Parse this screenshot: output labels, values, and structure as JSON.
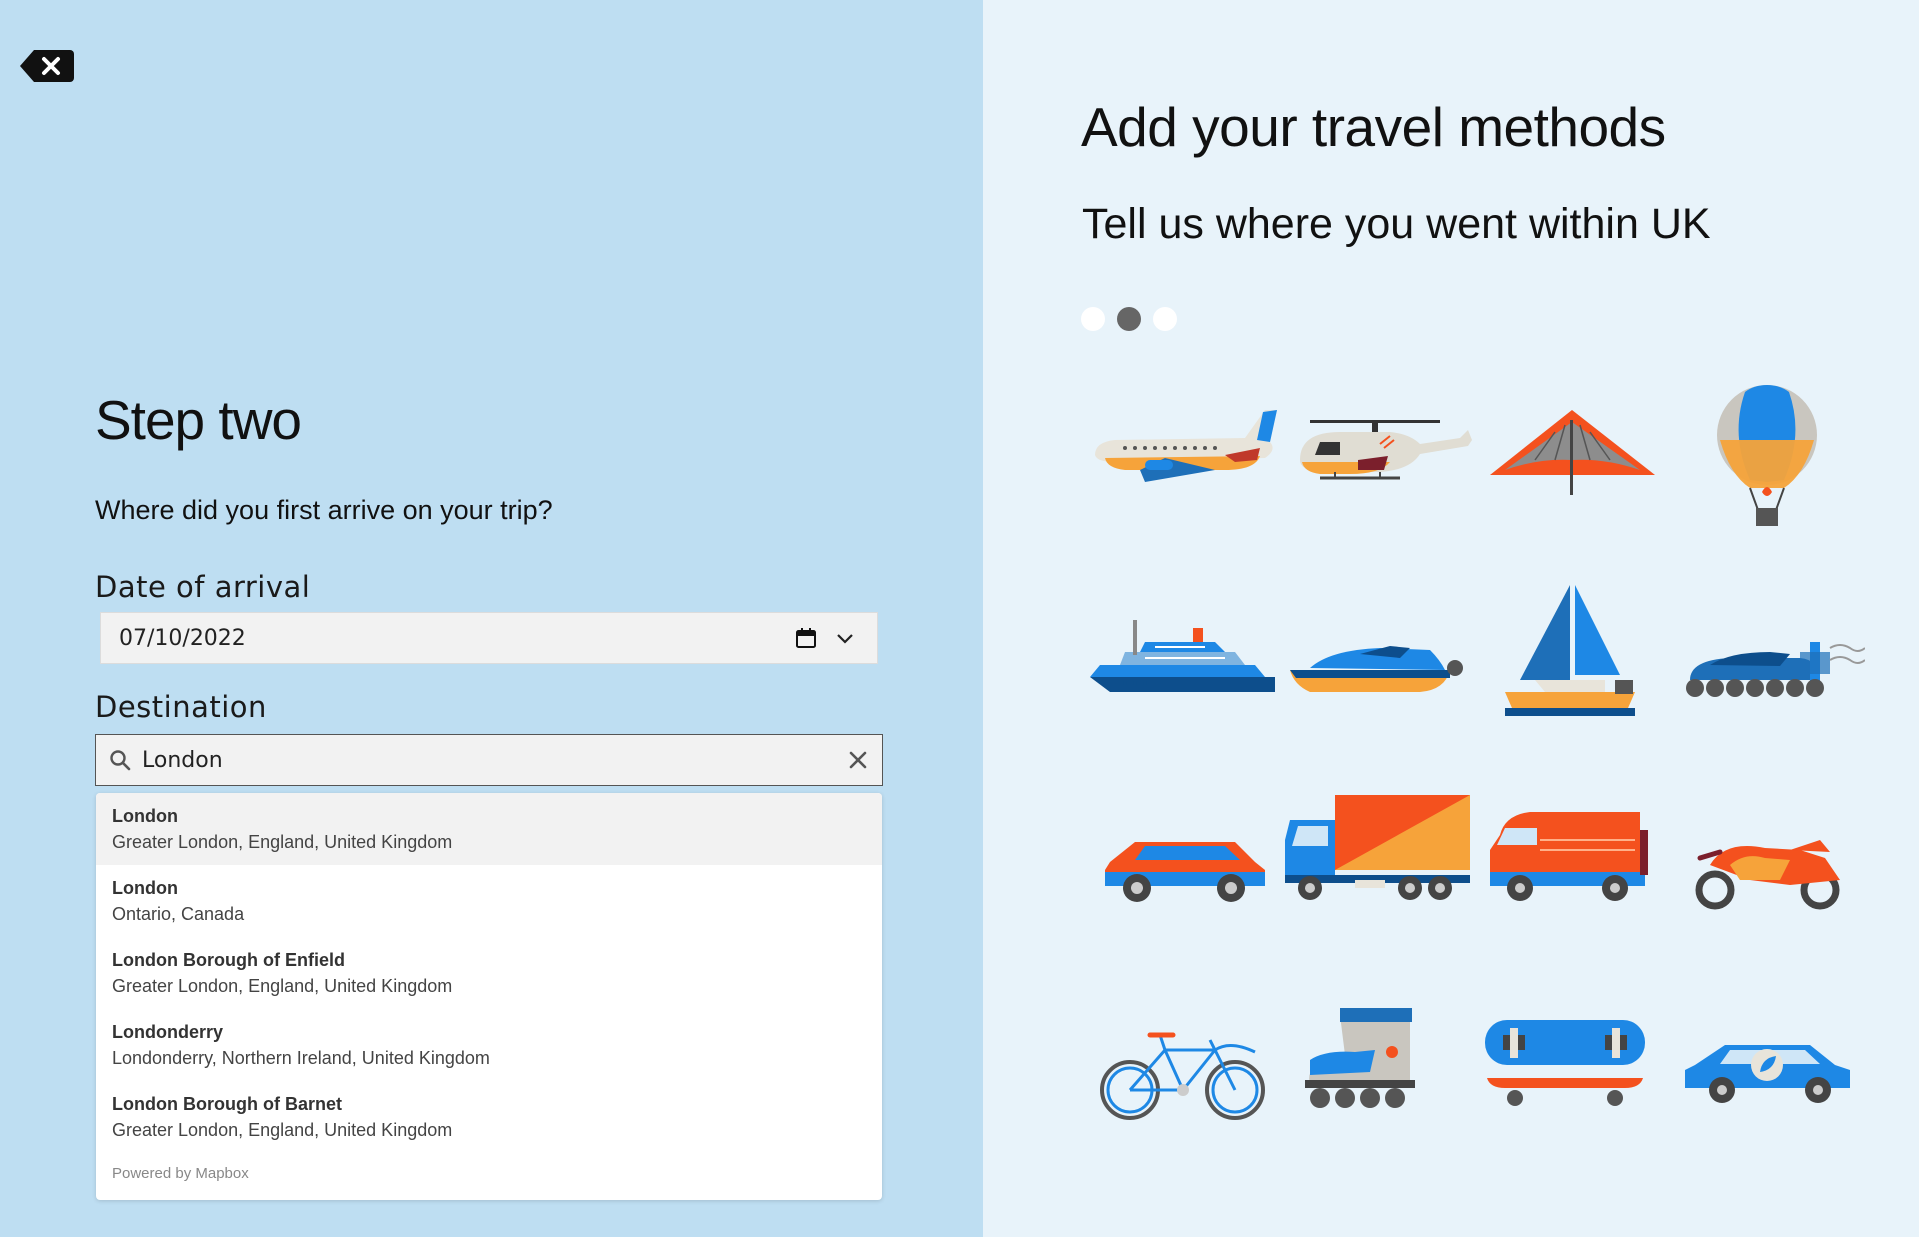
{
  "left": {
    "back_icon": "backspace-close-icon",
    "step_title": "Step two",
    "question": "Where did you first arrive on your trip?",
    "date_label": "Date of arrival",
    "date_value": "07/10/2022",
    "destination_label": "Destination",
    "search_value": "London",
    "suggestions": [
      {
        "name": "London",
        "place": "Greater London, England, United Kingdom"
      },
      {
        "name": "London",
        "place": "Ontario, Canada"
      },
      {
        "name": "London Borough of Enfield",
        "place": "Greater London, England, United Kingdom"
      },
      {
        "name": "Londonderry",
        "place": "Londonderry, Northern Ireland, United Kingdom"
      },
      {
        "name": "London Borough of Barnet",
        "place": "Greater London, England, United Kingdom"
      }
    ],
    "powered_by": "Powered by Mapbox"
  },
  "right": {
    "heading": "Add your travel methods",
    "subheading": "Tell us where you went within UK",
    "progress": {
      "total_steps": 3,
      "current_step": 2
    },
    "vehicles": [
      "airplane-icon",
      "helicopter-icon",
      "hang-glider-icon",
      "hot-air-balloon-icon",
      "cruise-ship-icon",
      "speedboat-icon",
      "sailboat-icon",
      "hovercraft-icon",
      "car-icon",
      "truck-icon",
      "van-icon",
      "motorcycle-icon",
      "bicycle-icon",
      "rollerblade-icon",
      "skateboard-icon",
      "electric-car-icon"
    ]
  },
  "colors": {
    "left_bg": "#bedef2",
    "right_bg": "#e8f3fa",
    "accent_blue": "#1e88e5",
    "accent_orange": "#f4511e",
    "accent_yellow": "#f6a33a"
  }
}
